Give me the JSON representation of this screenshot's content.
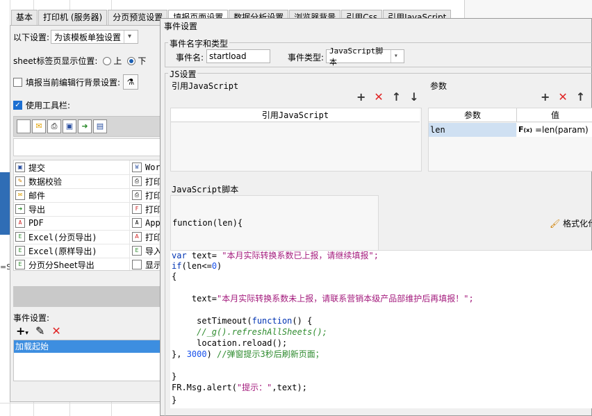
{
  "tabs": [
    "基本",
    "打印机 (服务器)",
    "分页预览设置",
    "填报页面设置",
    "数据分析设置",
    "浏览器背景",
    "引用Css",
    "引用JavaScript"
  ],
  "left_panel": {
    "setting_label": "以下设置:",
    "setting_value": "为该模板单独设置",
    "sheet_tab_label": "sheet标签页显示位置:",
    "radio_top": "上",
    "radio_bottom": "下",
    "bg_setting_label": "填报当前编辑行背景设置:",
    "use_toolbar_label": "使用工具栏:",
    "buttons_left": [
      "提交",
      "数据校验",
      "邮件",
      "导出",
      "PDF",
      "Excel(分页导出)",
      "Excel(原样导出)",
      "分页分Sheet导出"
    ],
    "buttons_right": [
      "Word",
      "打印",
      "打印",
      "打印",
      "Appl",
      "打印",
      "导入",
      "显示"
    ],
    "event_settings_label": "事件设置:",
    "event_items": [
      "加载起始"
    ]
  },
  "dialog": {
    "title": "事件设置",
    "name_type_group": "事件名字和类型",
    "event_name_label": "事件名:",
    "event_name_value": "startload",
    "event_type_label": "事件类型:",
    "event_type_value": "JavaScript脚本",
    "js_group": "JS设置",
    "ref_js_label": "引用JavaScript",
    "params_label": "参数",
    "ref_js_column": "引用JavaScript",
    "param_columns": [
      "参数",
      "值"
    ],
    "param_rows": [
      {
        "name": "len",
        "value": "=len(param)"
      }
    ],
    "script_label": "JavaScript脚本",
    "function_header": "function(len){",
    "format_button": "格式化代",
    "code_lines": [
      "var text= \"本月实际转换系数已上报，请继续填报\";",
      "if(len<=0)",
      "{",
      "",
      "    text=\"本月实际转换系数未上报，请联系营销本级产品部维护后再填报！\";",
      "",
      "     setTimeout(function() {",
      "     //_g().refreshAllSheets();",
      "     location.reload();",
      "}, 3000) //弹窗提示3秒后刷新页面；",
      "",
      "}",
      "FR.Msg.alert(\"提示：\",text);",
      "}"
    ]
  },
  "icons": [
    "plus-icon",
    "delete-icon",
    "arrow-up-icon",
    "arrow-down-icon",
    "edit-icon",
    "brush-icon",
    "formula-icon"
  ]
}
